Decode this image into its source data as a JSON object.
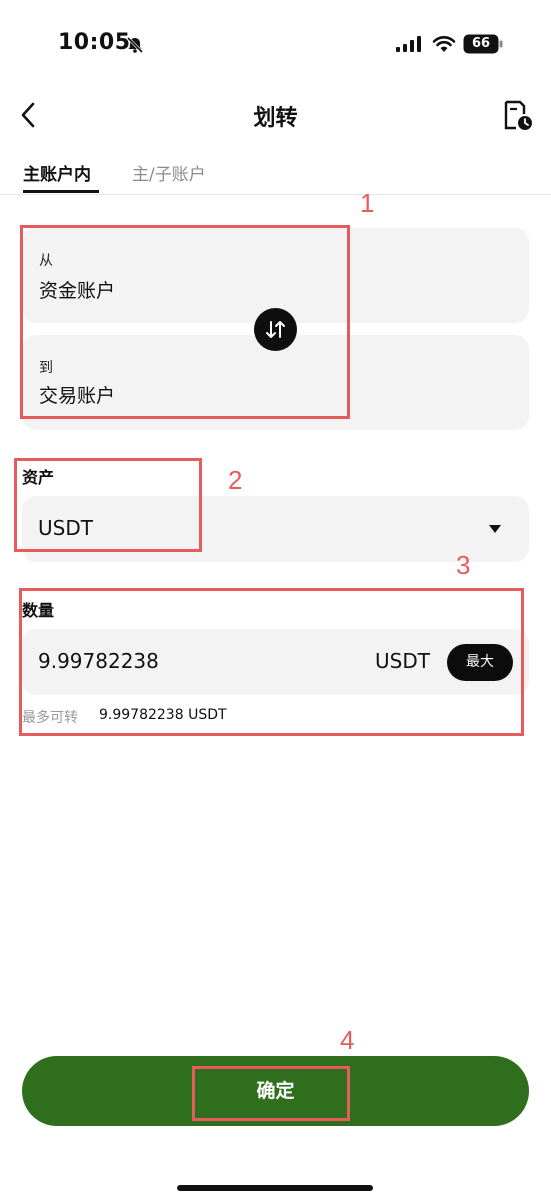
{
  "status_bar": {
    "time": "10:05",
    "battery": "66"
  },
  "nav": {
    "title": "划转"
  },
  "tabs": [
    {
      "label": "主账户内",
      "active": true
    },
    {
      "label": "主/子账户",
      "active": false
    }
  ],
  "transfer": {
    "from_label": "从",
    "from_account": "资金账户",
    "to_label": "到",
    "to_account": "交易账户"
  },
  "asset": {
    "label": "资产",
    "value": "USDT"
  },
  "quantity": {
    "label": "数量",
    "value": "9.99782238",
    "unit": "USDT",
    "max_button": "最大",
    "max_transfer_label": "最多可转",
    "max_transfer_amount": "9.99782238 USDT"
  },
  "confirm_button": "确定",
  "annotations": [
    "1",
    "2",
    "3",
    "4"
  ],
  "colors": {
    "accent_green": "#2f6e1d",
    "annotation_red": "#e65c5c"
  }
}
